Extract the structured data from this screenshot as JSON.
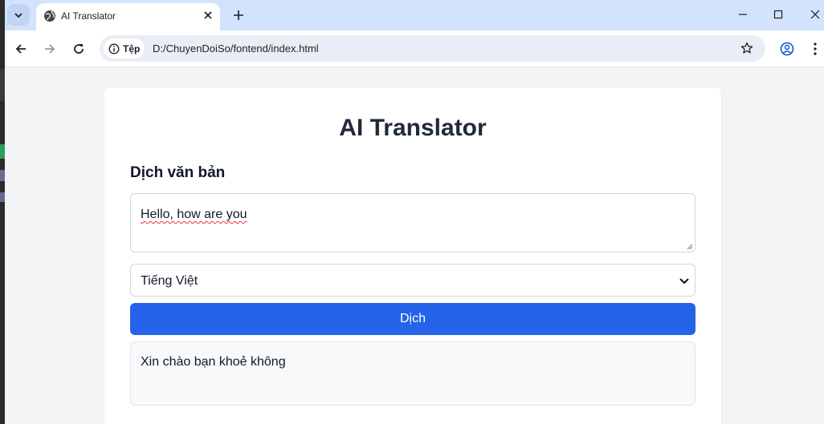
{
  "browser": {
    "tab_title": "AI Translator",
    "site_chip_label": "Tệp",
    "url": "D:/ChuyenDoiSo/fontend/index.html",
    "icons": [
      "tab-search-icon",
      "globe-icon",
      "close-icon",
      "plus-icon",
      "minimize-icon",
      "maximize-icon",
      "window-close-icon",
      "back-arrow-icon",
      "forward-arrow-icon",
      "reload-icon",
      "info-icon",
      "star-icon",
      "profile-icon",
      "more-vert-icon"
    ]
  },
  "page": {
    "title": "AI Translator",
    "section_title": "Dịch văn bản",
    "input_value": "Hello, how are you",
    "language_select": {
      "selected": "Tiếng Việt"
    },
    "translate_button": "Dịch",
    "result_text": "Xin chào bạn khoẻ không"
  },
  "colors": {
    "accent": "#2563eb",
    "tabbar": "#d3e3fd",
    "page_bg": "#f3f4f6"
  }
}
